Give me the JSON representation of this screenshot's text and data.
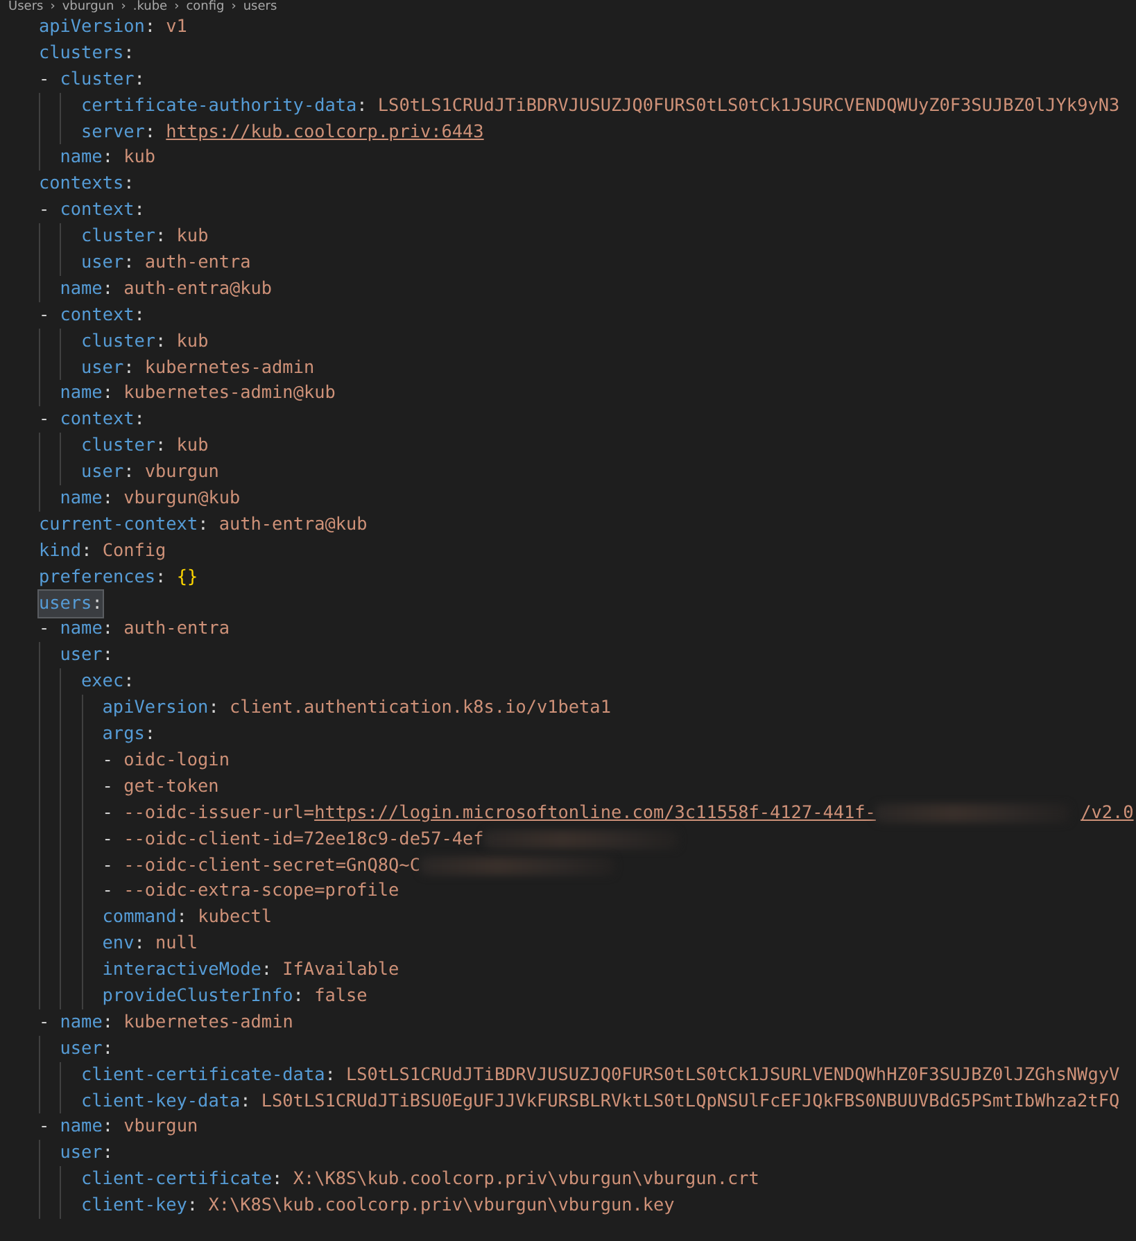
{
  "breadcrumb": {
    "separator": "›",
    "items": [
      "Users",
      "vburgun",
      ".kube",
      "config",
      "users"
    ]
  },
  "lines": [
    {
      "highlighted": false,
      "tokens": [
        {
          "kind": "key",
          "text": "apiVersion",
          "sep": ":"
        },
        {
          "kind": "string",
          "text": "v1"
        }
      ]
    },
    {
      "highlighted": false,
      "tokens": [
        {
          "kind": "key",
          "text": "clusters",
          "sep": ":"
        }
      ]
    },
    {
      "dash": "-",
      "entries": [
        {
          "highlighted": false,
          "tokens": [
            {
              "kind": "key",
              "text": "cluster",
              "sep": ":"
            }
          ],
          "children": [
            {
              "highlighted": false,
              "tokens": [
                {
                  "kind": "key",
                  "text": "certificate-authority-data",
                  "sep": ":"
                },
                {
                  "kind": "string",
                  "text": "LS0tLS1CRUdJTiBDRVJUSUZJQ0FURS0tLS0tCk1JSURCVENDQWUyZ0F3SUJBZ0lJYk9yN3"
                }
              ]
            },
            {
              "highlighted": false,
              "tokens": [
                {
                  "kind": "key",
                  "text": "server",
                  "sep": ":"
                },
                {
                  "kind": "link",
                  "text": "https://kub.coolcorp.priv:6443"
                }
              ]
            }
          ]
        },
        {
          "highlighted": false,
          "tokens": [
            {
              "kind": "key",
              "text": "name",
              "sep": ":"
            },
            {
              "kind": "string",
              "text": "kub"
            }
          ]
        }
      ]
    },
    {
      "highlighted": false,
      "tokens": [
        {
          "kind": "key",
          "text": "contexts",
          "sep": ":"
        }
      ]
    },
    {
      "dash": "-",
      "entries": [
        {
          "highlighted": false,
          "tokens": [
            {
              "kind": "key",
              "text": "context",
              "sep": ":"
            }
          ],
          "children": [
            {
              "highlighted": false,
              "tokens": [
                {
                  "kind": "key",
                  "text": "cluster",
                  "sep": ":"
                },
                {
                  "kind": "string",
                  "text": "kub"
                }
              ]
            },
            {
              "highlighted": false,
              "tokens": [
                {
                  "kind": "key",
                  "text": "user",
                  "sep": ":"
                },
                {
                  "kind": "string",
                  "text": "auth-entra"
                }
              ]
            }
          ]
        },
        {
          "highlighted": false,
          "tokens": [
            {
              "kind": "key",
              "text": "name",
              "sep": ":"
            },
            {
              "kind": "string",
              "text": "auth-entra@kub"
            }
          ]
        }
      ]
    },
    {
      "dash": "-",
      "entries": [
        {
          "highlighted": false,
          "tokens": [
            {
              "kind": "key",
              "text": "context",
              "sep": ":"
            }
          ],
          "children": [
            {
              "highlighted": false,
              "tokens": [
                {
                  "kind": "key",
                  "text": "cluster",
                  "sep": ":"
                },
                {
                  "kind": "string",
                  "text": "kub"
                }
              ]
            },
            {
              "highlighted": false,
              "tokens": [
                {
                  "kind": "key",
                  "text": "user",
                  "sep": ":"
                },
                {
                  "kind": "string",
                  "text": "kubernetes-admin"
                }
              ]
            }
          ]
        },
        {
          "highlighted": false,
          "tokens": [
            {
              "kind": "key",
              "text": "name",
              "sep": ":"
            },
            {
              "kind": "string",
              "text": "kubernetes-admin@kub"
            }
          ]
        }
      ]
    },
    {
      "dash": "-",
      "entries": [
        {
          "highlighted": false,
          "tokens": [
            {
              "kind": "key",
              "text": "context",
              "sep": ":"
            }
          ],
          "children": [
            {
              "highlighted": false,
              "tokens": [
                {
                  "kind": "key",
                  "text": "cluster",
                  "sep": ":"
                },
                {
                  "kind": "string",
                  "text": "kub"
                }
              ]
            },
            {
              "highlighted": false,
              "tokens": [
                {
                  "kind": "key",
                  "text": "user",
                  "sep": ":"
                },
                {
                  "kind": "string",
                  "text": "vburgun"
                }
              ]
            }
          ]
        },
        {
          "highlighted": false,
          "tokens": [
            {
              "kind": "key",
              "text": "name",
              "sep": ":"
            },
            {
              "kind": "string",
              "text": "vburgun@kub"
            }
          ]
        }
      ]
    },
    {
      "highlighted": false,
      "tokens": [
        {
          "kind": "key",
          "text": "current-context",
          "sep": ":"
        },
        {
          "kind": "string",
          "text": "auth-entra@kub"
        }
      ]
    },
    {
      "highlighted": false,
      "tokens": [
        {
          "kind": "key",
          "text": "kind",
          "sep": ":"
        },
        {
          "kind": "string",
          "text": "Config"
        }
      ]
    },
    {
      "highlighted": false,
      "tokens": [
        {
          "kind": "key",
          "text": "preferences",
          "sep": ":"
        },
        {
          "kind": "brace",
          "text": "{}"
        }
      ]
    },
    {
      "highlighted": true,
      "tokens": [
        {
          "kind": "key",
          "text": "users",
          "sep": ":"
        }
      ]
    },
    {
      "dash": "-",
      "entries": [
        {
          "highlighted": false,
          "tokens": [
            {
              "kind": "key",
              "text": "name",
              "sep": ":"
            },
            {
              "kind": "string",
              "text": "auth-entra"
            }
          ]
        },
        {
          "highlighted": false,
          "tokens": [
            {
              "kind": "key",
              "text": "user",
              "sep": ":"
            }
          ],
          "children": [
            {
              "highlighted": false,
              "tokens": [
                {
                  "kind": "key",
                  "text": "exec",
                  "sep": ":"
                }
              ],
              "children": [
                {
                  "highlighted": false,
                  "tokens": [
                    {
                      "kind": "key",
                      "text": "apiVersion",
                      "sep": ":"
                    },
                    {
                      "kind": "string",
                      "text": "client.authentication.k8s.io/v1beta1"
                    }
                  ]
                },
                {
                  "highlighted": false,
                  "tokens": [
                    {
                      "kind": "key",
                      "text": "args",
                      "sep": ":"
                    }
                  ]
                },
                {
                  "dash": "-",
                  "entries": [
                    {
                      "highlighted": false,
                      "tokens": [
                        {
                          "kind": "string",
                          "text": "oidc-login"
                        }
                      ]
                    }
                  ]
                },
                {
                  "dash": "-",
                  "entries": [
                    {
                      "highlighted": false,
                      "tokens": [
                        {
                          "kind": "string",
                          "text": "get-token"
                        }
                      ]
                    }
                  ]
                },
                {
                  "dash": "-",
                  "entries": [
                    {
                      "highlighted": false,
                      "tokens": [
                        {
                          "kind": "string",
                          "text": "--oidc-issuer-url="
                        },
                        {
                          "kind": "link",
                          "text": "https://login.microsoftonline.com/3c11558f-4127-441f-"
                        },
                        {
                          "kind": "redacted"
                        },
                        {
                          "kind": "link",
                          "text": "/v2.0"
                        }
                      ]
                    }
                  ]
                },
                {
                  "dash": "-",
                  "entries": [
                    {
                      "highlighted": false,
                      "tokens": [
                        {
                          "kind": "string",
                          "text": "--oidc-client-id=72ee18c9-de57-4ef"
                        },
                        {
                          "kind": "redacted"
                        }
                      ]
                    }
                  ]
                },
                {
                  "dash": "-",
                  "entries": [
                    {
                      "highlighted": false,
                      "tokens": [
                        {
                          "kind": "string",
                          "text": "--oidc-client-secret=GnQ8Q~C"
                        },
                        {
                          "kind": "redacted"
                        }
                      ]
                    }
                  ]
                },
                {
                  "dash": "-",
                  "entries": [
                    {
                      "highlighted": false,
                      "tokens": [
                        {
                          "kind": "string",
                          "text": "--oidc-extra-scope=profile"
                        }
                      ]
                    }
                  ]
                },
                {
                  "highlighted": false,
                  "tokens": [
                    {
                      "kind": "key",
                      "text": "command",
                      "sep": ":"
                    },
                    {
                      "kind": "string",
                      "text": "kubectl"
                    }
                  ]
                },
                {
                  "highlighted": false,
                  "tokens": [
                    {
                      "kind": "key",
                      "text": "env",
                      "sep": ":"
                    },
                    {
                      "kind": "string",
                      "text": "null"
                    }
                  ]
                },
                {
                  "highlighted": false,
                  "tokens": [
                    {
                      "kind": "key",
                      "text": "interactiveMode",
                      "sep": ":"
                    },
                    {
                      "kind": "string",
                      "text": "IfAvailable"
                    }
                  ]
                },
                {
                  "highlighted": false,
                  "tokens": [
                    {
                      "kind": "key",
                      "text": "provideClusterInfo",
                      "sep": ":"
                    },
                    {
                      "kind": "string",
                      "text": "false"
                    }
                  ]
                }
              ]
            }
          ]
        }
      ]
    },
    {
      "dash": "-",
      "entries": [
        {
          "highlighted": false,
          "tokens": [
            {
              "kind": "key",
              "text": "name",
              "sep": ":"
            },
            {
              "kind": "string",
              "text": "kubernetes-admin"
            }
          ]
        },
        {
          "highlighted": false,
          "tokens": [
            {
              "kind": "key",
              "text": "user",
              "sep": ":"
            }
          ],
          "children": [
            {
              "highlighted": false,
              "tokens": [
                {
                  "kind": "key",
                  "text": "client-certificate-data",
                  "sep": ":"
                },
                {
                  "kind": "string",
                  "text": "LS0tLS1CRUdJTiBDRVJUSUZJQ0FURS0tLS0tCk1JSURLVENDQWhHZ0F3SUJBZ0lJZGhsNWgyV"
                }
              ]
            },
            {
              "highlighted": false,
              "tokens": [
                {
                  "kind": "key",
                  "text": "client-key-data",
                  "sep": ":"
                },
                {
                  "kind": "string",
                  "text": "LS0tLS1CRUdJTiBSU0EgUFJJVkFURSBLRVktLS0tLQpNSUlFcEFJQkFBS0NBUUVBdG5PSmtIbWhza2tFQ"
                }
              ]
            }
          ]
        }
      ]
    },
    {
      "dash": "-",
      "entries": [
        {
          "highlighted": false,
          "tokens": [
            {
              "kind": "key",
              "text": "name",
              "sep": ":"
            },
            {
              "kind": "string",
              "text": "vburgun"
            }
          ]
        },
        {
          "highlighted": false,
          "tokens": [
            {
              "kind": "key",
              "text": "user",
              "sep": ":"
            }
          ],
          "children": [
            {
              "highlighted": false,
              "tokens": [
                {
                  "kind": "key",
                  "text": "client-certificate",
                  "sep": ":"
                },
                {
                  "kind": "string",
                  "text": "X:\\K8S\\kub.coolcorp.priv\\vburgun\\vburgun.crt"
                }
              ]
            },
            {
              "highlighted": false,
              "tokens": [
                {
                  "kind": "key",
                  "text": "client-key",
                  "sep": ":"
                },
                {
                  "kind": "string",
                  "text": "X:\\K8S\\kub.coolcorp.priv\\vburgun\\vburgun.key"
                }
              ]
            }
          ]
        }
      ]
    }
  ]
}
